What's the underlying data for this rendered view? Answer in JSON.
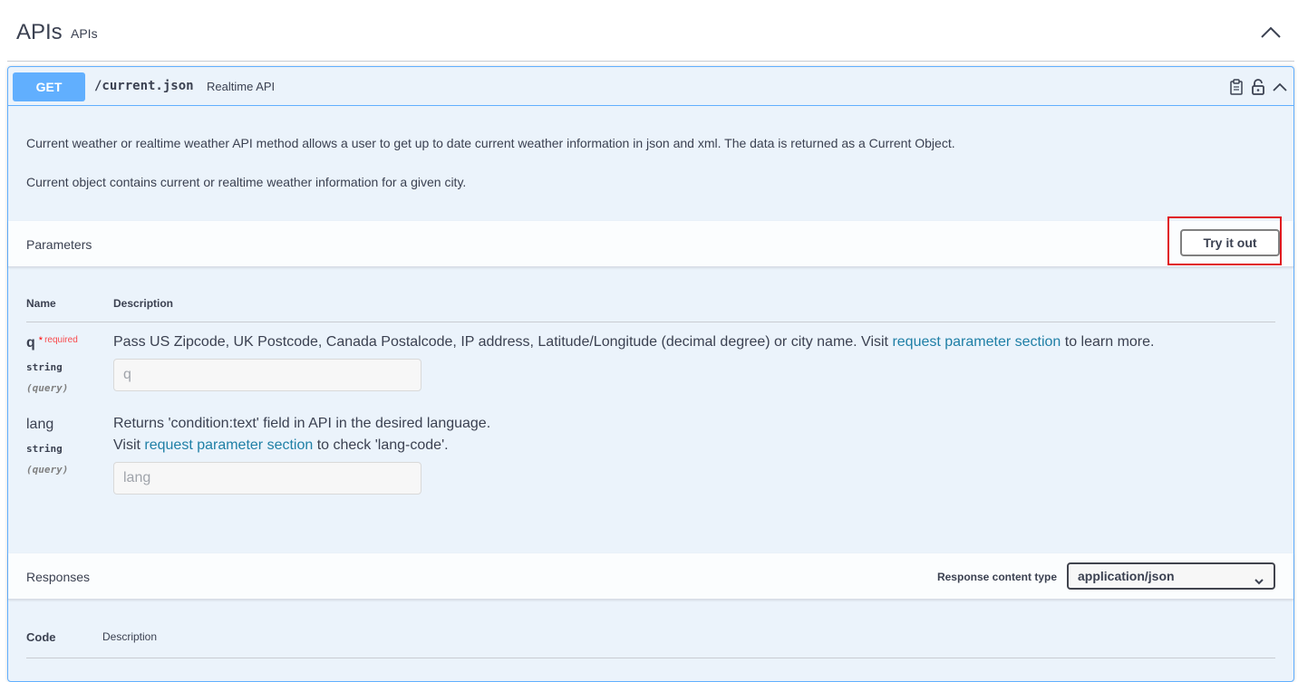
{
  "tag": {
    "name": "APIs",
    "description": "APIs"
  },
  "operation": {
    "method": "GET",
    "path": "/current.json",
    "summary": "Realtime API",
    "description": [
      "Current weather or realtime weather API method allows a user to get up to date current weather information in json and xml. The data is returned as a Current Object.",
      "Current object contains current or realtime weather information for a given city."
    ]
  },
  "parameters": {
    "title": "Parameters",
    "try_it_out": "Try it out",
    "col_name": "Name",
    "col_description": "Description",
    "items": [
      {
        "name": "q",
        "required_star": "*",
        "required_label": "required",
        "type": "string",
        "in": "(query)",
        "desc_before": "Pass US Zipcode, UK Postcode, Canada Postalcode, IP address, Latitude/Longitude (decimal degree) or city name. Visit ",
        "link": "request parameter section",
        "desc_after": " to learn more.",
        "placeholder": "q"
      },
      {
        "name": "lang",
        "type": "string",
        "in": "(query)",
        "desc_line1": "Returns 'condition:text' field in API in the desired language.",
        "desc_before": "Visit ",
        "link": "request parameter section",
        "desc_after": " to check 'lang-code'.",
        "placeholder": "lang"
      }
    ]
  },
  "responses": {
    "title": "Responses",
    "content_type_label": "Response content type",
    "content_type_value": "application/json",
    "col_code": "Code",
    "col_description": "Description"
  },
  "colors": {
    "get": "#61affe",
    "opblock_bg": "#ebf3fb",
    "link": "#1f7fa6",
    "highlight": "#e0161e"
  },
  "icons": {
    "collapse": "chevron-up-icon",
    "copy": "clipboard-icon",
    "lock": "lock-icon",
    "op_collapse": "chevron-up-icon",
    "select": "chevron-down-icon"
  }
}
